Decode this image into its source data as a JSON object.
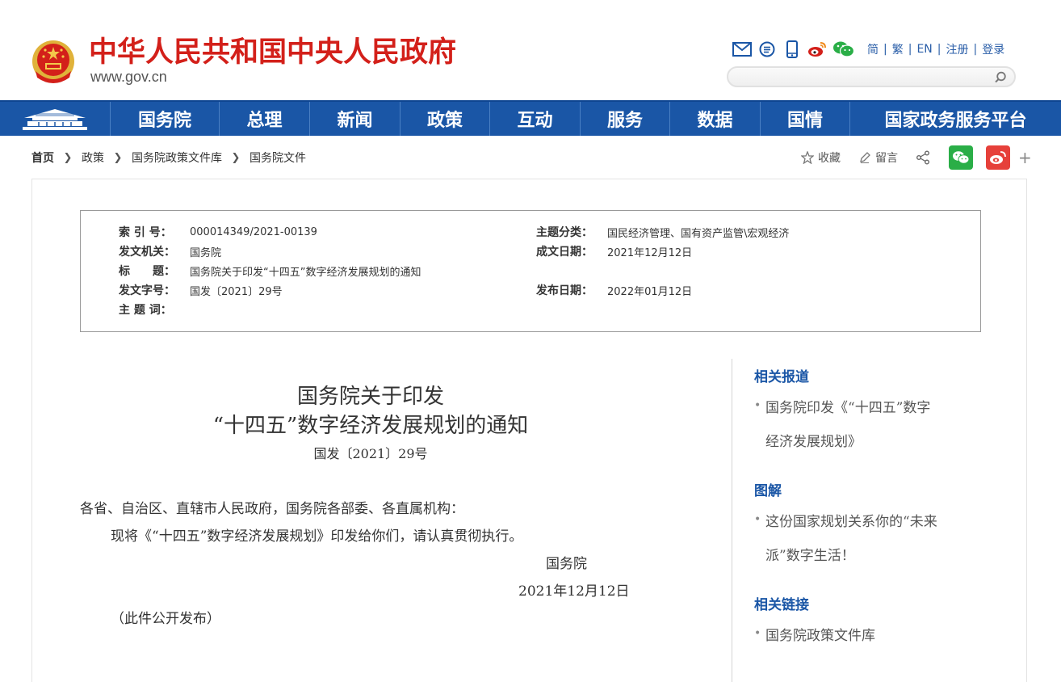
{
  "header": {
    "site_title": "中华人民共和国中央人民政府",
    "site_domain": "www.gov.cn",
    "util_icons": [
      "mail-icon",
      "message-icon",
      "mobile-icon",
      "weibo-icon",
      "wechat-icon"
    ],
    "util_links": [
      "简",
      "繁",
      "EN",
      "注册",
      "登录"
    ],
    "search_placeholder": ""
  },
  "nav": {
    "items": [
      "国务院",
      "总理",
      "新闻",
      "政策",
      "互动",
      "服务",
      "数据",
      "国情",
      "国家政务服务平台"
    ]
  },
  "breadcrumb": {
    "items": [
      "首页",
      "政策",
      "国务院政策文件库",
      "国务院文件"
    ]
  },
  "share": {
    "favorite_label": "收藏",
    "comment_label": "留言",
    "plus": "+"
  },
  "info": {
    "index_label": "索 引 号：",
    "index_value": "000014349/2021-00139",
    "topic_label": "主题分类：",
    "topic_value": "国民经济管理、国有资产监管\\宏观经济",
    "issuer_label": "发文机关：",
    "issuer_value": "国务院",
    "created_label": "成文日期：",
    "created_value": "2021年12月12日",
    "title_label": "标　　题：",
    "title_value": "国务院关于印发“十四五”数字经济发展规划的通知",
    "docno_label": "发文字号：",
    "docno_value": "国发〔2021〕29号",
    "published_label": "发布日期：",
    "published_value": "2022年01月12日",
    "keywords_label": "主 题 词：",
    "keywords_value": ""
  },
  "doc": {
    "title_line1": "国务院关于印发",
    "title_line2": "“十四五”数字经济发展规划的通知",
    "doc_number": "国发〔2021〕29号",
    "salutation": "各省、自治区、直辖市人民政府，国务院各部委、各直属机构：",
    "body": "现将《“十四五”数字经济发展规划》印发给你们，请认真贯彻执行。",
    "signature": "国务院",
    "date": "2021年12月12日",
    "note": "（此件公开发布）"
  },
  "sidebar": {
    "sections": [
      {
        "heading": "相关报道",
        "items": [
          [
            "国务院印发《“十四五”数字",
            "经济发展规划》"
          ]
        ]
      },
      {
        "heading": "图解",
        "items": [
          [
            "这份国家规划关系你的“未来",
            "派”数字生活！"
          ]
        ]
      },
      {
        "heading": "相关链接",
        "items": [
          [
            "国务院政策文件库"
          ]
        ]
      }
    ]
  },
  "colors": {
    "brand_red": "#d3201a",
    "nav_blue": "#1a56a6",
    "link_blue": "#2a5ea8",
    "wechat_green": "#2aae47",
    "weibo_red": "#e6403a"
  }
}
